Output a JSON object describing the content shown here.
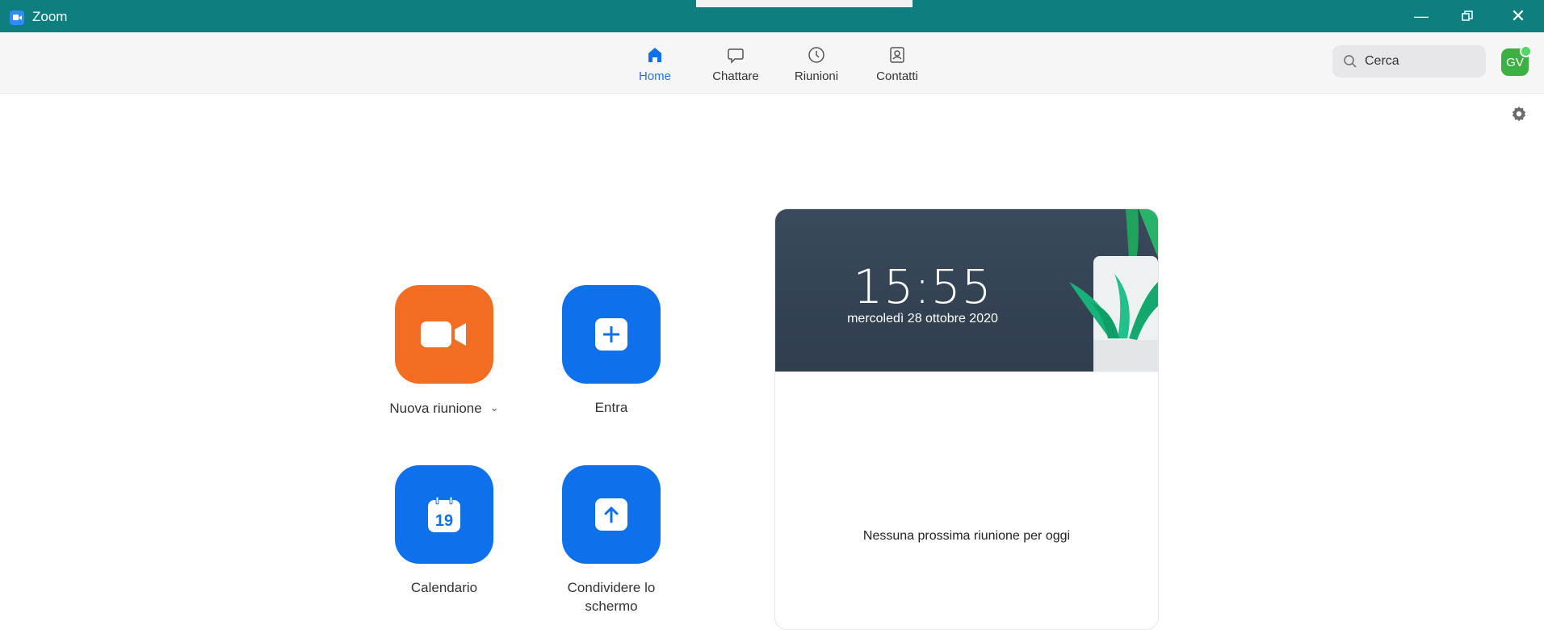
{
  "window": {
    "title": "Zoom"
  },
  "nav": {
    "tabs": [
      {
        "label": "Home",
        "icon": "home-icon",
        "active": true
      },
      {
        "label": "Chattare",
        "icon": "chat-icon",
        "active": false
      },
      {
        "label": "Riunioni",
        "icon": "clock-icon",
        "active": false
      },
      {
        "label": "Contatti",
        "icon": "contacts-icon",
        "active": false
      }
    ],
    "search_placeholder": "Cerca",
    "avatar_initials": "GV"
  },
  "actions": [
    {
      "label": "Nuova riunione",
      "color": "#f26d21",
      "icon": "video-camera-icon",
      "dropdown": true
    },
    {
      "label": "Entra",
      "color": "#0e71eb",
      "icon": "plus-icon"
    },
    {
      "label": "Calendario",
      "color": "#0e71eb",
      "icon": "calendar-icon",
      "calendar_day": "19"
    },
    {
      "label_line1": "Condividere lo",
      "label_line2": "schermo",
      "color": "#0e71eb",
      "icon": "share-screen-icon"
    }
  ],
  "card": {
    "time": "15:55",
    "date": "mercoledì 28 ottobre 2020",
    "empty_message": "Nessuna prossima riunione per oggi"
  },
  "colors": {
    "titlebar": "#0e7f7e",
    "accent": "#0e71eb",
    "orange": "#f26d21"
  }
}
